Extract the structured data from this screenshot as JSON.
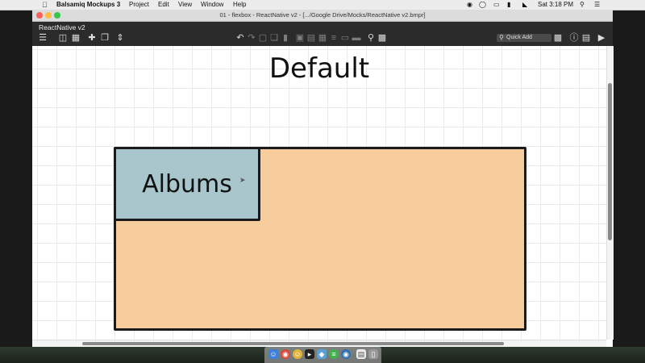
{
  "menubar": {
    "app_name": "Balsamiq Mockups 3",
    "menus": [
      "Project",
      "Edit",
      "View",
      "Window",
      "Help"
    ],
    "clock": "Sat 3:18 PM"
  },
  "window": {
    "title": "01 - flexbox - ReactNative v2 - [.../Google Drive/Mocks/ReactNative v2.bmpr]"
  },
  "toolbar": {
    "project_name": "ReactNative v2",
    "quick_add_label": "Quick Add"
  },
  "mockup": {
    "heading": "Default",
    "albums_label": "Albums",
    "outer_box_color": "#f7cd9e",
    "albums_box_color": "#a8c6cc"
  },
  "icons": {
    "menubar_right": [
      "record-icon",
      "glasses-icon",
      "airplay-icon",
      "battery-icon",
      "wifi-icon",
      "search-icon",
      "list-icon"
    ],
    "dock": [
      "finder-icon",
      "chrome-icon",
      "face-icon",
      "terminal-icon",
      "app-icon",
      "spotify-icon",
      "chrome-canary-icon",
      "document-icon",
      "trash-icon"
    ]
  }
}
